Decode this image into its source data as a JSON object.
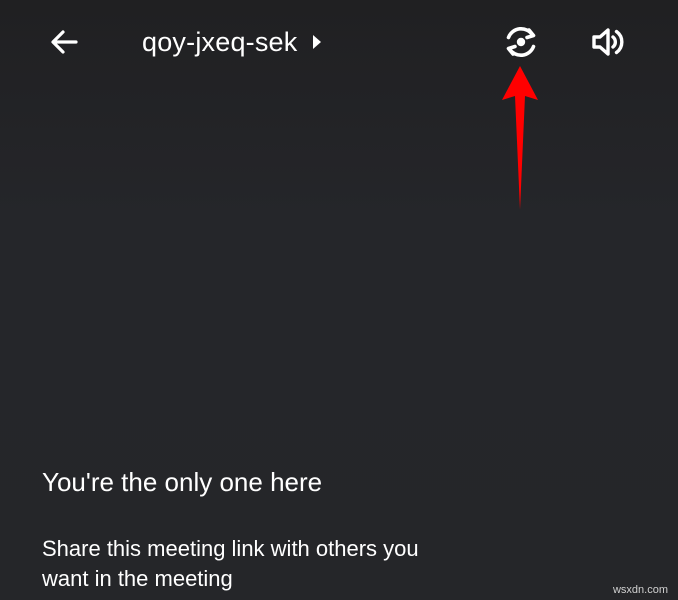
{
  "header": {
    "meeting_code": "qoy-jxeq-sek",
    "icons": {
      "back": "arrow-back-icon",
      "chevron": "chevron-right-icon",
      "switch_camera": "switch-camera-icon",
      "speaker": "speaker-icon"
    }
  },
  "main": {
    "title": "You're the only one here",
    "description": "Share this meeting link with others you want in the meeting"
  },
  "annotation": {
    "color": "#ff0000"
  },
  "watermark": "wsxdn.com",
  "colors": {
    "background": "#252629",
    "text": "#ffffff"
  }
}
